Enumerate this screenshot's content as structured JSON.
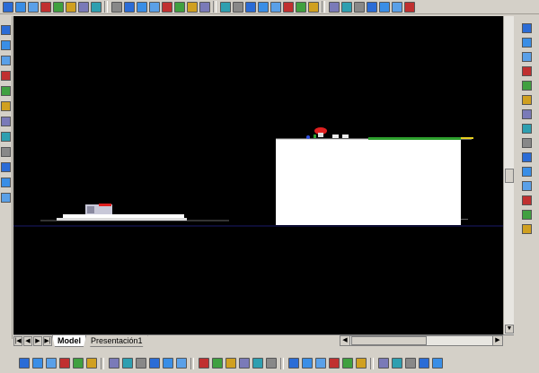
{
  "layout_tabs": [
    {
      "label": "Model",
      "active": true
    },
    {
      "label": "Presentación1",
      "active": false
    }
  ],
  "colors": {
    "canvas_bg": "#000000",
    "chrome_bg": "#d4d0c8",
    "building": "#ffffff",
    "ground_line": "#1a1a6a",
    "roof_green": "#2ea02e",
    "roof_red": "#e02020",
    "roof_yellow": "#e8d020"
  },
  "icons": {
    "top_toolbar": [
      "new-icon",
      "open-icon",
      "save-icon",
      "print-icon",
      "preview-icon",
      "plot-icon",
      "cut-icon",
      "copy-icon",
      "paste-icon",
      "match-props-icon",
      "undo-icon",
      "redo-icon",
      "zoom-icon",
      "pan-icon",
      "view-top-icon",
      "view-front-icon",
      "view-left-icon",
      "view-right-icon",
      "view-bottom-icon",
      "view-back-icon",
      "view-iso-sw-icon",
      "view-iso-se-icon",
      "view-iso-ne-icon",
      "view-iso-nw-icon",
      "orbit-icon",
      "render-icon",
      "shade-2d-icon",
      "shade-3d-icon",
      "hidden-icon",
      "flat-shade-icon",
      "gouraud-icon"
    ],
    "left_toolbar": [
      "target-icon",
      "layer-icon",
      "properties-icon",
      "list-icon",
      "ucs-icon",
      "snap-icon",
      "grid-icon",
      "ortho-icon",
      "polar-icon",
      "osnap-icon",
      "draw-icon",
      "link-icon"
    ],
    "right_toolbar": [
      "pencil-icon",
      "copy-object-icon",
      "mirror-icon",
      "offset-icon",
      "array-icon",
      "move-icon",
      "rotate-icon",
      "scale-icon",
      "stretch-icon",
      "trim-icon",
      "extend-icon",
      "break-icon",
      "chamfer-icon",
      "fillet-icon",
      "explode-icon"
    ],
    "bottom_toolbar": [
      "line-icon",
      "polyline-icon",
      "arc-icon",
      "circle-icon",
      "spline-icon",
      "ellipse-icon",
      "insert-icon",
      "block-icon",
      "point-icon",
      "hatch-icon",
      "region-icon",
      "text-icon",
      "dim-linear-icon",
      "dim-aligned-icon",
      "dim-radius-icon",
      "dim-diameter-icon",
      "dim-angular-icon",
      "tolerance-icon",
      "center-mark-icon",
      "leader-icon",
      "dim-edit-icon",
      "dim-style-icon",
      "extrude-icon",
      "revolve-icon",
      "slice-icon",
      "section-icon",
      "union-icon",
      "subtract-icon",
      "intersect-icon"
    ]
  }
}
